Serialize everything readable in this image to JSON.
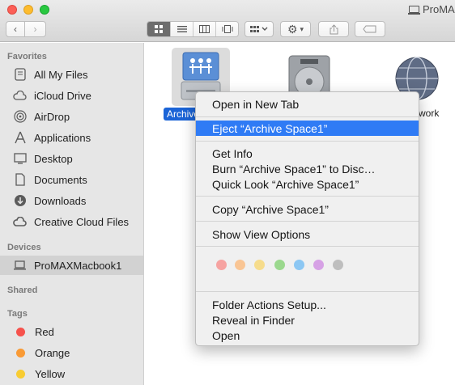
{
  "window": {
    "title": "ProMA"
  },
  "toolbar": {
    "back_icon": "chevron-left-icon",
    "forward_icon": "chevron-right-icon",
    "view_modes": [
      "icon-view",
      "list-view",
      "column-view",
      "cover-flow-view"
    ],
    "active_view": "icon-view"
  },
  "sidebar": {
    "favorites_header": "Favorites",
    "favorites": [
      {
        "label": "All My Files",
        "icon": "all-files-icon"
      },
      {
        "label": "iCloud Drive",
        "icon": "cloud-icon"
      },
      {
        "label": "AirDrop",
        "icon": "airdrop-icon"
      },
      {
        "label": "Applications",
        "icon": "applications-icon"
      },
      {
        "label": "Desktop",
        "icon": "desktop-icon"
      },
      {
        "label": "Documents",
        "icon": "documents-icon"
      },
      {
        "label": "Downloads",
        "icon": "downloads-icon"
      },
      {
        "label": "Creative Cloud Files",
        "icon": "creative-cloud-icon"
      }
    ],
    "devices_header": "Devices",
    "devices": [
      {
        "label": "ProMAXMacbook1",
        "icon": "laptop-icon",
        "selected": true
      }
    ],
    "shared_header": "Shared",
    "tags_header": "Tags",
    "tags": [
      {
        "label": "Red",
        "color": "#f6524c"
      },
      {
        "label": "Orange",
        "color": "#f99a35"
      },
      {
        "label": "Yellow",
        "color": "#f8cc32"
      }
    ]
  },
  "main": {
    "items": [
      {
        "label": "Archive",
        "icon": "network-share-icon",
        "selected": true
      },
      {
        "label": "",
        "icon": "hard-disk-icon",
        "selected": false
      },
      {
        "label": "work",
        "icon": "network-globe-icon",
        "selected": false
      }
    ]
  },
  "context_menu": {
    "items": [
      {
        "label": "Open in New Tab",
        "highlighted": false
      },
      {
        "label": "Eject “Archive Space1”",
        "highlighted": true
      },
      {
        "label": "Get Info",
        "highlighted": false
      },
      {
        "label": "Burn “Archive Space1” to Disc…",
        "highlighted": false
      },
      {
        "label": "Quick Look “Archive Space1”",
        "highlighted": false
      },
      {
        "label": "Copy “Archive Space1”",
        "highlighted": false
      },
      {
        "label": "Show View Options",
        "highlighted": false
      },
      {
        "label": "Folder Actions Setup...",
        "highlighted": false
      },
      {
        "label": "Reveal in Finder",
        "highlighted": false
      },
      {
        "label": "Open",
        "highlighted": false
      }
    ],
    "tag_colors": [
      "#f6a3a1",
      "#f9c594",
      "#f6dc8c",
      "#9bd88e",
      "#8cc7f3",
      "#d6a1e5",
      "#bebebe"
    ]
  }
}
